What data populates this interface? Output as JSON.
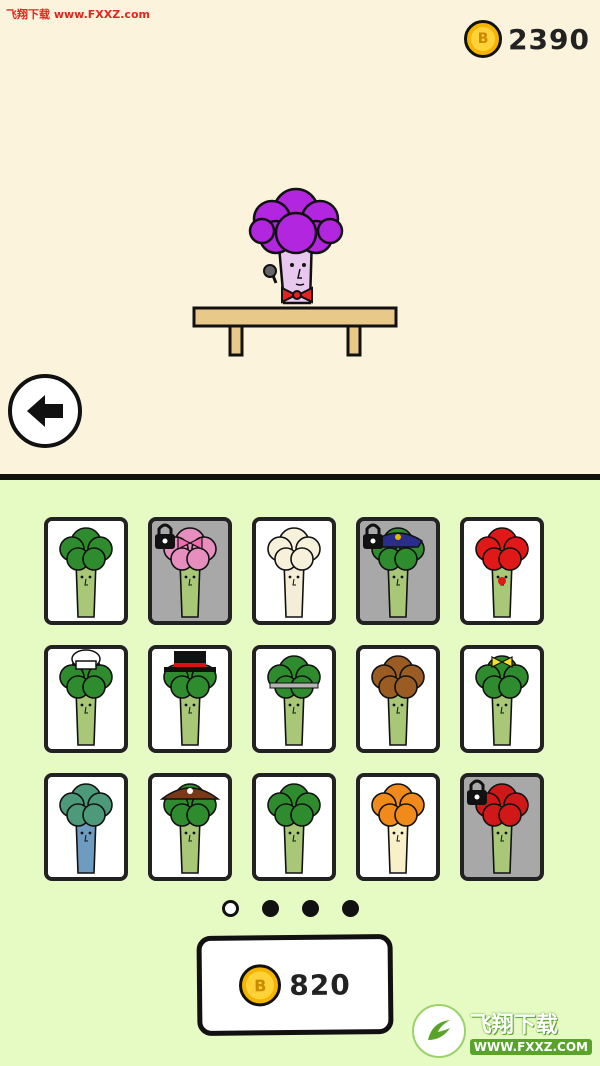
{
  "watermark": {
    "top_text": "飞翔下载 www.FXXZ.com"
  },
  "coins": {
    "icon_letter": "B",
    "balance": "2390"
  },
  "stage": {
    "character": "purple-afro-singer-broccoli"
  },
  "skins": [
    {
      "id": "classic-broccoli",
      "hair": "#2e8b2e",
      "locked": false,
      "accessory": "none"
    },
    {
      "id": "pink-bow-broccoli",
      "hair": "#e68fbf",
      "locked": true,
      "accessory": "bow"
    },
    {
      "id": "cauliflower",
      "hair": "#f7f1dc",
      "locked": false,
      "accessory": "none"
    },
    {
      "id": "police-broccoli",
      "hair": "#2e8b2e",
      "locked": true,
      "accessory": "police-hat"
    },
    {
      "id": "clown-broccoli",
      "hair": "#e01818",
      "locked": false,
      "accessory": "clown"
    },
    {
      "id": "chef-broccoli",
      "hair": "#2e8b2e",
      "locked": false,
      "accessory": "chef-hat"
    },
    {
      "id": "magician-broccoli",
      "hair": "#2e8b2e",
      "locked": false,
      "accessory": "top-hat"
    },
    {
      "id": "soccer-broccoli",
      "hair": "#2e8b2e",
      "locked": false,
      "accessory": "headband"
    },
    {
      "id": "cat-afro-broccoli",
      "hair": "#9a5c22",
      "locked": false,
      "accessory": "cat"
    },
    {
      "id": "cheerleader-broccoli",
      "hair": "#2e8b2e",
      "locked": false,
      "accessory": "bow-yellow"
    },
    {
      "id": "zombie-broccoli",
      "hair": "#4d9a7a",
      "locked": false,
      "accessory": "zombie"
    },
    {
      "id": "pirate-broccoli",
      "hair": "#2e8b2e",
      "locked": false,
      "accessory": "pirate-hat"
    },
    {
      "id": "underwear-broccoli",
      "hair": "#2e8b2e",
      "locked": false,
      "accessory": "briefs"
    },
    {
      "id": "orange-afro-broccoli",
      "hair": "#f08a1a",
      "locked": false,
      "accessory": "none"
    },
    {
      "id": "basketball-broccoli",
      "hair": "#d11818",
      "locked": true,
      "accessory": "basketball"
    }
  ],
  "pagination": {
    "pages": 4,
    "current": 1
  },
  "buy": {
    "price": "820"
  },
  "logo": {
    "title": "飞翔下载",
    "url": "WWW.FXXZ.COM"
  }
}
